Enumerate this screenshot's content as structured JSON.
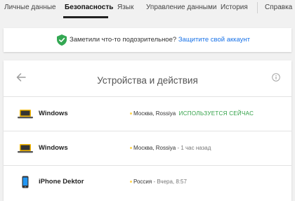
{
  "nav": {
    "tabs": [
      {
        "label": "Личные данные",
        "active": false
      },
      {
        "label": "Безопасность",
        "active": true
      },
      {
        "label": "Язык",
        "active": false
      },
      {
        "label": "Управление данными",
        "active": false
      },
      {
        "label": "История",
        "active": false
      },
      {
        "label": "Справка",
        "active": false
      }
    ]
  },
  "alert": {
    "text": "Заметили что-то подозрительное?",
    "link": "Защитите свой аккаунт",
    "icon": "shield-check-icon",
    "accent": "#34a853",
    "link_color": "#1a73e8"
  },
  "devices": {
    "title": "Устройства и действия",
    "items": [
      {
        "name": "Windows",
        "location": "Москва, Rossiya",
        "status": "ИСПОЛЬЗУЕТСЯ СЕЙЧАС",
        "icon": "laptop-icon",
        "current": true
      },
      {
        "name": "Windows",
        "location": "Москва, Rossiya",
        "status": "1 час назад",
        "icon": "laptop-icon",
        "current": false
      },
      {
        "name": "iPhone Dektor",
        "location": "Россия",
        "status": "Вчера, 8:57",
        "icon": "phone-icon",
        "current": false
      }
    ]
  }
}
